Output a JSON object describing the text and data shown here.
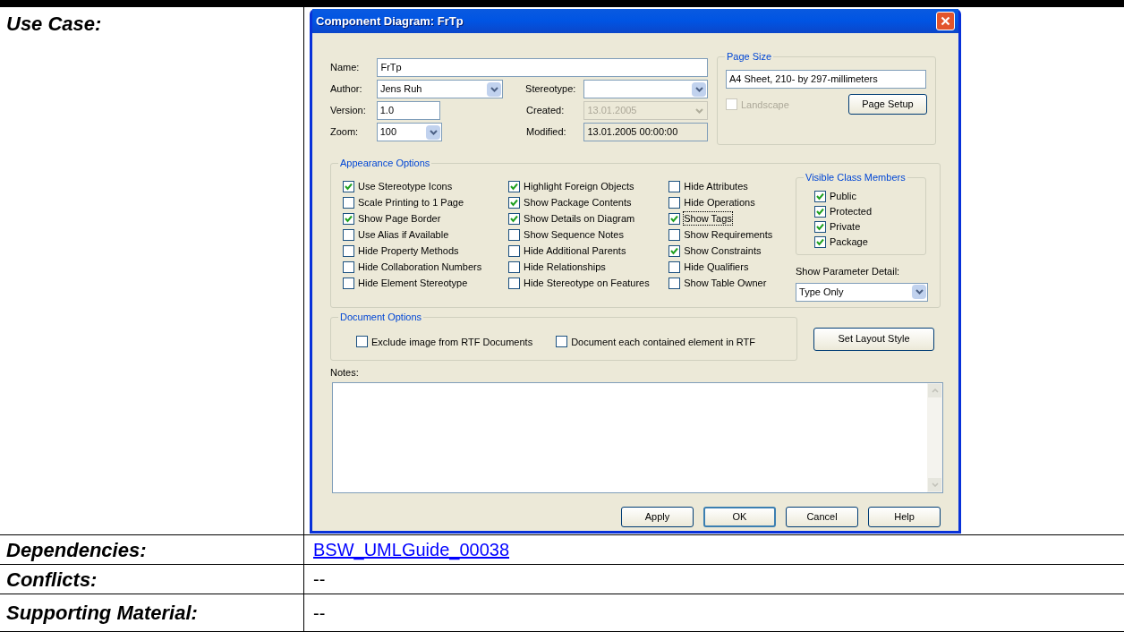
{
  "use_case": {
    "label": "Use Case:"
  },
  "dialog": {
    "title": "Component Diagram: FrTp",
    "general": {
      "name_label": "Name:",
      "name": "FrTp",
      "author_label": "Author:",
      "author": "Jens Ruh",
      "version_label": "Version:",
      "version": "1.0",
      "zoom_label": "Zoom:",
      "zoom": "100",
      "stereotype_label": "Stereotype:",
      "created_label": "Created:",
      "created": "13.01.2005",
      "created_disabled": true,
      "modified_label": "Modified:",
      "modified": "13.01.2005 00:00:00"
    },
    "page_size": {
      "title": "Page Size",
      "value": "A4 Sheet, 210- by 297-millimeters",
      "landscape": {
        "label": "Landscape",
        "checked": false,
        "disabled": true
      },
      "button": "Page Setup"
    },
    "appearance": {
      "title": "Appearance Options",
      "columns": [
        [
          {
            "label": "Use Stereotype Icons",
            "checked": true
          },
          {
            "label": "Scale Printing to 1 Page",
            "checked": false
          },
          {
            "label": "Show Page Border",
            "checked": true
          },
          {
            "label": "Use Alias if Available",
            "checked": false
          },
          {
            "label": "Hide Property Methods",
            "checked": false
          },
          {
            "label": "Hide Collaboration Numbers",
            "checked": false
          },
          {
            "label": "Hide Element Stereotype",
            "checked": false
          }
        ],
        [
          {
            "label": "Highlight Foreign Objects",
            "checked": true
          },
          {
            "label": "Show Package Contents",
            "checked": true
          },
          {
            "label": "Show Details on Diagram",
            "checked": true
          },
          {
            "label": "Show Sequence Notes",
            "checked": false
          },
          {
            "label": "Hide Additional Parents",
            "checked": false
          },
          {
            "label": "Hide Relationships",
            "checked": false
          },
          {
            "label": "Hide Stereotype on Features",
            "checked": false
          }
        ],
        [
          {
            "label": "Hide Attributes",
            "checked": false
          },
          {
            "label": "Hide Operations",
            "checked": false
          },
          {
            "label": "Show Tags",
            "checked": true,
            "focused": true
          },
          {
            "label": "Show Requirements",
            "checked": false
          },
          {
            "label": "Show Constraints",
            "checked": true
          },
          {
            "label": "Hide Qualifiers",
            "checked": false
          },
          {
            "label": "Show Table Owner",
            "checked": false
          }
        ]
      ],
      "visible_members": {
        "title": "Visible Class Members",
        "items": [
          {
            "label": "Public",
            "checked": true
          },
          {
            "label": "Protected",
            "checked": true
          },
          {
            "label": "Private",
            "checked": true
          },
          {
            "label": "Package",
            "checked": true
          }
        ]
      },
      "parameter_detail_label": "Show Parameter Detail:",
      "parameter_detail": "Type Only"
    },
    "document": {
      "title": "Document Options",
      "items": [
        {
          "label": "Exclude image from RTF Documents",
          "checked": false
        },
        {
          "label": "Document each contained element in RTF",
          "checked": false
        }
      ],
      "layout_button": "Set Layout Style"
    },
    "notes_label": "Notes:",
    "buttons": [
      {
        "label": "Apply",
        "default": false
      },
      {
        "label": "OK",
        "default": true
      },
      {
        "label": "Cancel",
        "default": false
      },
      {
        "label": "Help",
        "default": false
      }
    ]
  },
  "rows": [
    {
      "label": "Dependencies:",
      "value": "BSW_UMLGuide_00038",
      "kind": "link"
    },
    {
      "label": "Conflicts:",
      "value": "--",
      "kind": "text"
    },
    {
      "label": "Supporting Material:",
      "value": "--",
      "kind": "text"
    }
  ]
}
